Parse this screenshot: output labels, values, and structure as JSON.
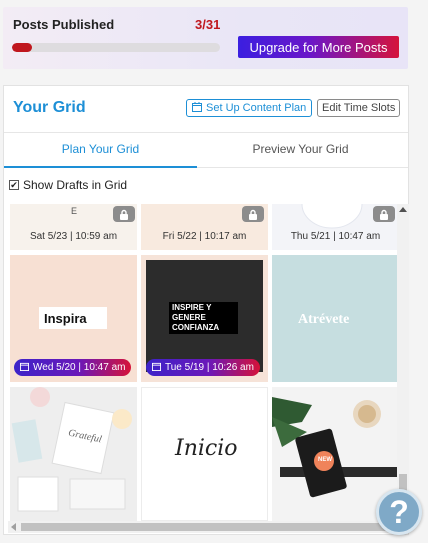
{
  "posts": {
    "label": "Posts Published",
    "count": "3/31",
    "progress": 0.0968,
    "upgrade_label": "Upgrade for More Posts"
  },
  "grid": {
    "title": "Your Grid",
    "setup_label": "Set Up Content Plan",
    "edit_label": "Edit Time Slots",
    "tabs": [
      "Plan Your Grid",
      "Preview Your Grid"
    ],
    "show_drafts_label": "Show Drafts in Grid",
    "show_drafts_checked": true,
    "row1": [
      {
        "date": "Sat 5/23 | 10:59 am",
        "letter": "E"
      },
      {
        "date": "Fri 5/22 | 10:17 am"
      },
      {
        "date": "Thu 5/21 | 10:47 am"
      }
    ],
    "row2": [
      {
        "date": "Wed 5/20 | 10:47 am",
        "text": "Inspira"
      },
      {
        "date": "Tue 5/19 | 10:26 am",
        "text_line1": "INSPIRE Y",
        "text_line2": "GENERE",
        "text_line3": "CONFIANZA"
      },
      {
        "text": "Atrévete"
      }
    ],
    "row3": [
      {
        "script": "Grateful"
      },
      {
        "script": "Inicio"
      },
      {
        "badge": "NEW"
      }
    ]
  },
  "colors": {
    "accent": "#1d8fd6",
    "count_red": "#c0171e",
    "gradient_start": "#3b1fe0",
    "gradient_end": "#d5133c"
  },
  "help_icon": "question-mark-icon"
}
